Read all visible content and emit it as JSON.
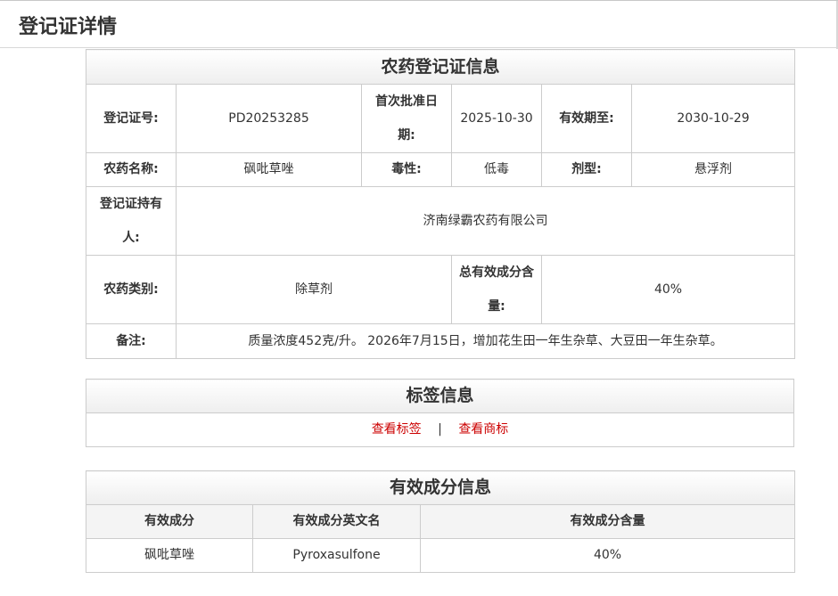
{
  "page": {
    "title": "登记证详情"
  },
  "registration": {
    "caption": "农药登记证信息",
    "reg_no_label": "登记证号:",
    "reg_no": "PD20253285",
    "first_approval_label": "首次批准日期:",
    "first_approval": "2025-10-30",
    "valid_until_label": "有效期至:",
    "valid_until": "2030-10-29",
    "pesticide_name_label": "农药名称:",
    "pesticide_name": "砜吡草唑",
    "toxicity_label": "毒性:",
    "toxicity": "低毒",
    "formulation_label": "剂型:",
    "formulation": "悬浮剂",
    "holder_label": "登记证持有人:",
    "holder": "济南绿霸农药有限公司",
    "category_label": "农药类别:",
    "category": "除草剂",
    "total_content_label": "总有效成分含量:",
    "total_content": "40%",
    "remarks_label": "备注:",
    "remarks": "质量浓度452克/升。 2026年7月15日，增加花生田一年生杂草、大豆田一年生杂草。"
  },
  "label_info": {
    "caption": "标签信息",
    "view_label_link": "查看标签",
    "separator": "|",
    "view_trademark_link": "查看商标"
  },
  "ingredients": {
    "caption": "有效成分信息",
    "headers": [
      "有效成分",
      "有效成分英文名",
      "有效成分含量"
    ],
    "rows": [
      [
        "砜吡草唑",
        "Pyroxasulfone",
        "40%"
      ]
    ]
  },
  "colors": {
    "link": "#cc0000",
    "border": "#cccccc",
    "text": "#333333"
  }
}
